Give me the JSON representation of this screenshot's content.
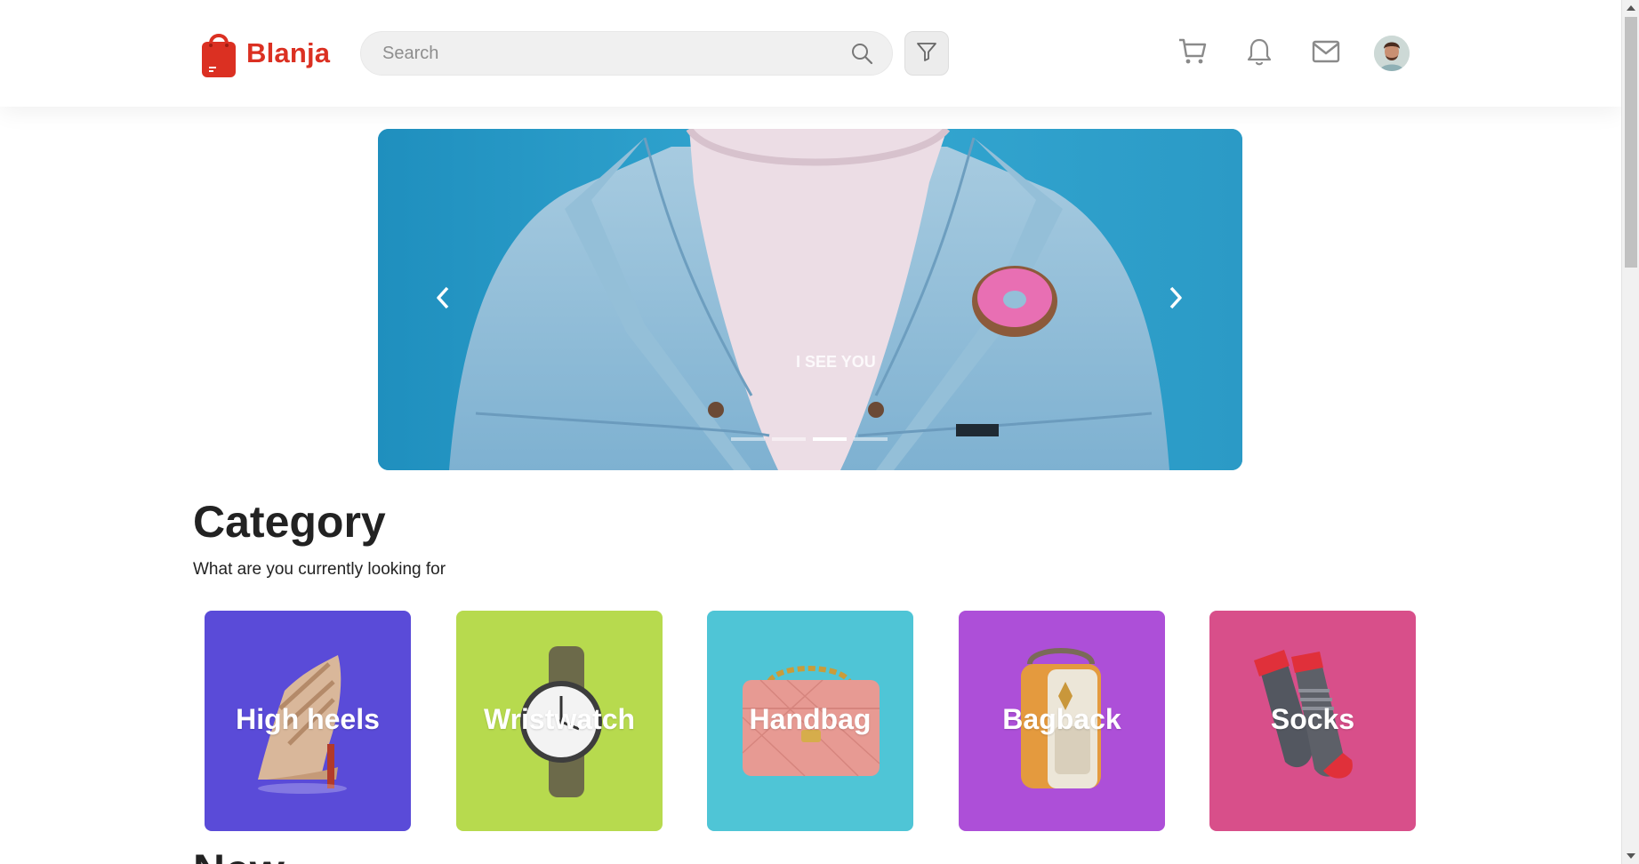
{
  "brand": {
    "name": "Blanja",
    "color": "#db3022"
  },
  "search": {
    "placeholder": "Search",
    "value": ""
  },
  "header_icons": {
    "search": "search-icon",
    "filter": "filter-icon",
    "cart": "cart-icon",
    "notifications": "bell-icon",
    "messages": "mail-icon",
    "profile": "avatar"
  },
  "carousel": {
    "slide_text": "I SEE YOU",
    "prev_icon": "chevron-left-icon",
    "next_icon": "chevron-right-icon",
    "indicator_count": 4,
    "active_index": 2
  },
  "category": {
    "title": "Category",
    "subtitle": "What are you currently looking for",
    "items": [
      {
        "label": "High heels",
        "color": "#5a4bd8"
      },
      {
        "label": "Wristwatch",
        "color": "#b7da4e"
      },
      {
        "label": "Handbag",
        "color": "#4fc5d6"
      },
      {
        "label": "Bagback",
        "color": "#ad4fd8"
      },
      {
        "label": "Socks",
        "color": "#d84f8a"
      }
    ]
  },
  "next_section": {
    "title": "New"
  }
}
